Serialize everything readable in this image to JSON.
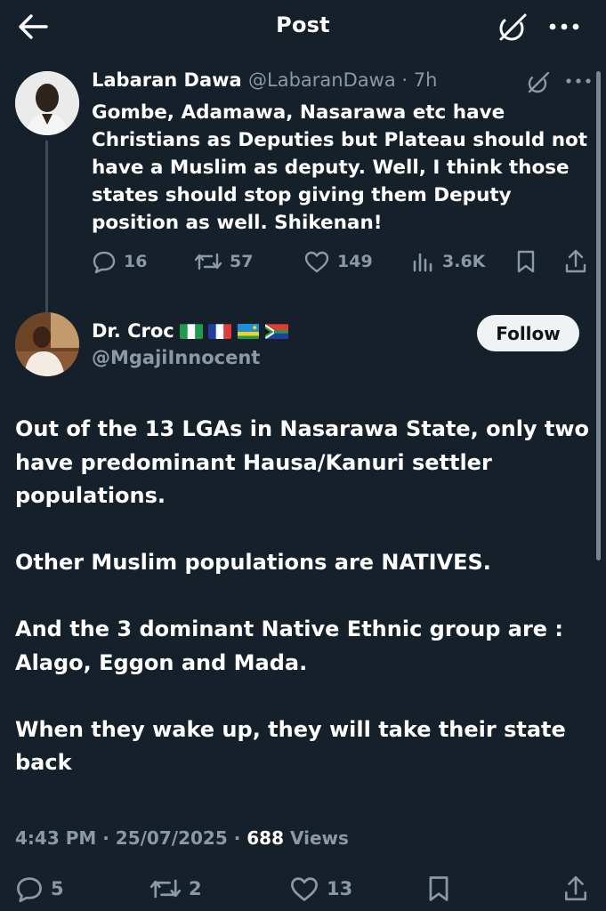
{
  "header": {
    "title": "Post",
    "back_icon": "arrow-left-icon",
    "grok_icon": "grok-icon",
    "more_icon": "more-horizontal-icon"
  },
  "quoted_post": {
    "author_name": "Labaran Dawa",
    "handle_time": "@LabaranDawa · 7h",
    "text": "Gombe, Adamawa, Nasarawa etc have Christians as Deputies but Plateau should not have a Muslim as deputy. Well, I think those states should stop giving them Deputy position as well. Shikenan!",
    "replies": "16",
    "reposts": "57",
    "likes": "149",
    "views": "3.6K"
  },
  "post": {
    "author_name": "Dr. Croc",
    "flags": [
      "Nigeria",
      "France",
      "Rwanda",
      "South Africa"
    ],
    "handle": "@MgajiInnocent",
    "follow_label": "Follow",
    "paragraphs": [
      "Out of the 13 LGAs in Nasarawa State, only two have predominant Hausa/Kanuri settler populations.",
      "Other Muslim populations are NATIVES.",
      "And the 3 dominant Native Ethnic group are : Alago, Eggon and Mada.",
      "When they wake up, they will take their state back"
    ],
    "timestamp": "4:43 PM · 25/07/2025 · ",
    "views_count": "688",
    "views_label": " Views",
    "replies": "5",
    "reposts": "2",
    "likes": "13"
  },
  "colors": {
    "background": "#15202b",
    "text": "#ffffff",
    "muted": "#8b98a5",
    "follow_bg": "#eff3f4"
  }
}
